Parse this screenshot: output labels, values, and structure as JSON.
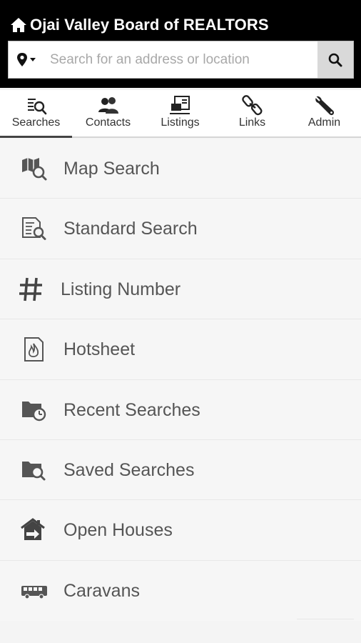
{
  "header": {
    "title": "Ojai Valley Board of REALTORS",
    "home_icon": "home-icon"
  },
  "search": {
    "placeholder": "Search for an address or location",
    "value": "",
    "location_icon": "map-pin-icon",
    "submit_icon": "search-icon"
  },
  "tabs": [
    {
      "label": "Searches",
      "icon": "search-list-icon",
      "active": true
    },
    {
      "label": "Contacts",
      "icon": "contacts-icon",
      "active": false
    },
    {
      "label": "Listings",
      "icon": "listings-icon",
      "active": false
    },
    {
      "label": "Links",
      "icon": "link-icon",
      "active": false
    },
    {
      "label": "Admin",
      "icon": "wrench-icon",
      "active": false
    }
  ],
  "menu": [
    {
      "label": "Map Search",
      "icon": "map-search-icon"
    },
    {
      "label": "Standard Search",
      "icon": "document-search-icon"
    },
    {
      "label": "Listing Number",
      "icon": "hash-icon"
    },
    {
      "label": "Hotsheet",
      "icon": "flame-document-icon"
    },
    {
      "label": "Recent Searches",
      "icon": "folder-clock-icon"
    },
    {
      "label": "Saved Searches",
      "icon": "folder-search-icon"
    },
    {
      "label": "Open Houses",
      "icon": "house-arrow-icon"
    },
    {
      "label": "Caravans",
      "icon": "bus-icon"
    }
  ],
  "colors": {
    "header_bg": "#000000",
    "accent": "#444444"
  }
}
